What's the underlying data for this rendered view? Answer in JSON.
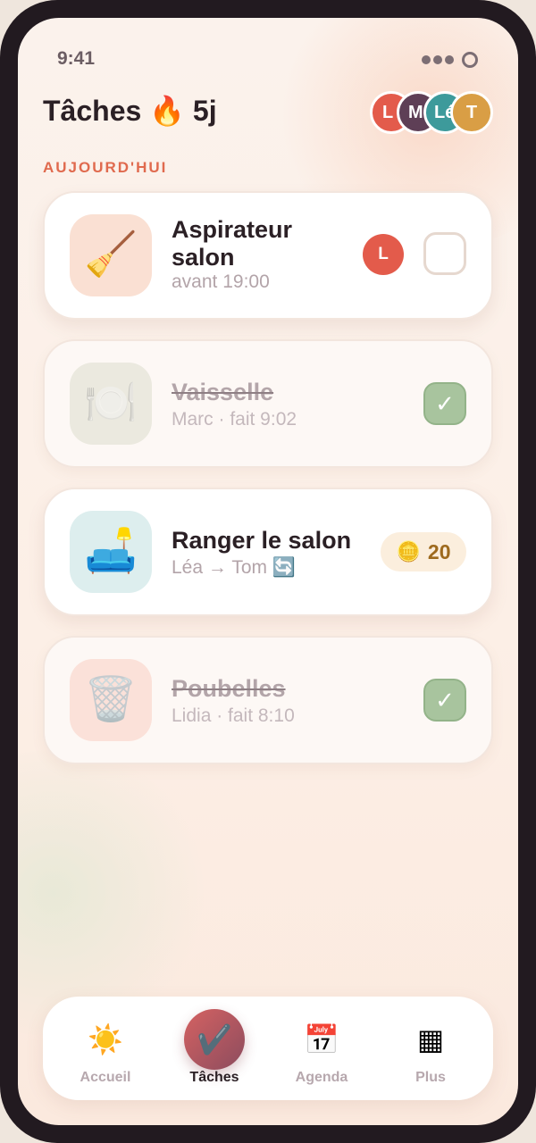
{
  "status_bar": {
    "time": "9:41"
  },
  "header": {
    "title": "Tâches 🔥 5j",
    "avatars": [
      {
        "initial": "L",
        "color": "#e35b4b"
      },
      {
        "initial": "M",
        "color": "#5e3f56"
      },
      {
        "initial": "Lé",
        "color": "#3d9a9b"
      },
      {
        "initial": "T",
        "color": "#d99e45"
      }
    ]
  },
  "section": {
    "label": "AUJOURD'HUI"
  },
  "tasks": [
    {
      "icon": "🧹",
      "title": "Aspirateur salon",
      "subtitle": "avant 19:00",
      "assignee": "L",
      "done": false
    },
    {
      "icon": "🍽️",
      "title": "Vaisselle",
      "subtitle": "Marc · fait 9:02",
      "check": "✓",
      "done": true
    },
    {
      "icon": "🛋️",
      "title": "Ranger le salon",
      "subtitle": "Léa → Tom 🔄",
      "coin_icon": "🪙",
      "coins": "20",
      "done": false
    },
    {
      "icon": "🗑️",
      "title": "Poubelles",
      "subtitle": "Lidia · fait 8:10",
      "check": "✓",
      "done": true
    }
  ],
  "tabbar": {
    "items": [
      {
        "icon": "☀️",
        "label": "Accueil"
      },
      {
        "icon": "✔️",
        "label": "Tâches",
        "active": true
      },
      {
        "icon": "📅",
        "label": "Agenda"
      },
      {
        "icon": "▦",
        "label": "Plus"
      }
    ]
  }
}
